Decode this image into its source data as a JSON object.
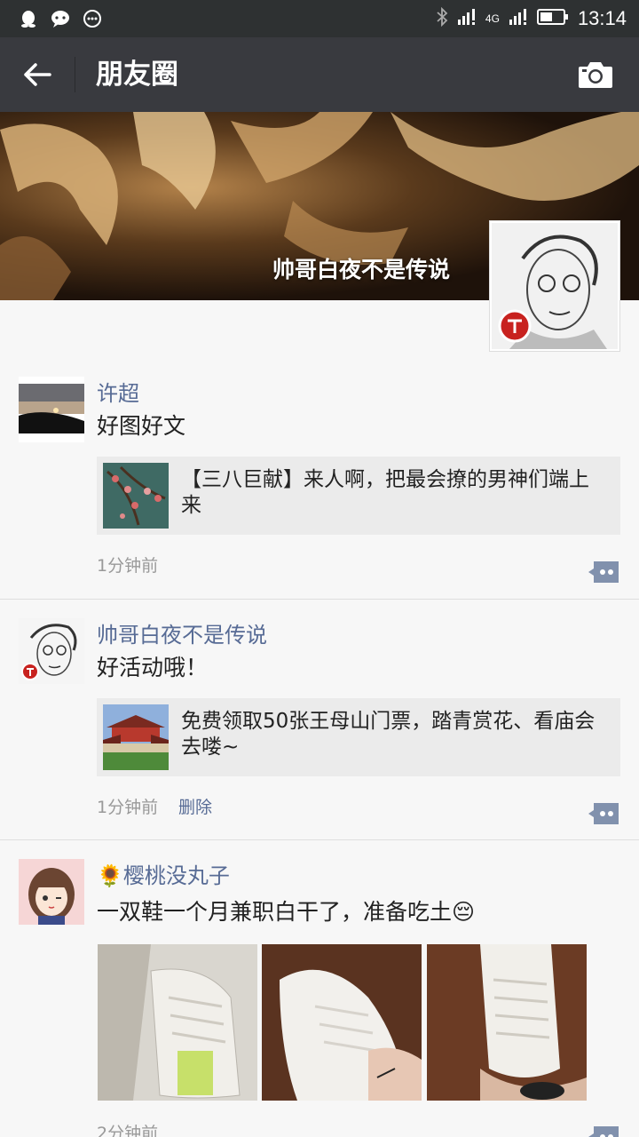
{
  "statusbar": {
    "network": "4G",
    "time": "13:14"
  },
  "titlebar": {
    "title": "朋友圈"
  },
  "cover": {
    "name": "帅哥白夜不是传说"
  },
  "posts": [
    {
      "nick": "许超",
      "text": "好图好文",
      "link_title": "【三八巨献】来人啊，把最会撩的男神们端上来",
      "time": "1分钟前"
    },
    {
      "nick": "帅哥白夜不是传说",
      "text": "好活动哦！",
      "link_title": "免费领取50张王母山门票，踏青赏花、看庙会去喽~",
      "time": "1分钟前",
      "delete_label": "删除"
    },
    {
      "nick": "🌻樱桃没丸子",
      "text": "一双鞋一个月兼职白干了，准备吃土😔",
      "time": "2分钟前"
    }
  ],
  "colors": {
    "statusbar": "#2e3132",
    "titlebar": "#393a3f",
    "nick": "#576b95",
    "feed_bg": "#f7f7f7"
  }
}
